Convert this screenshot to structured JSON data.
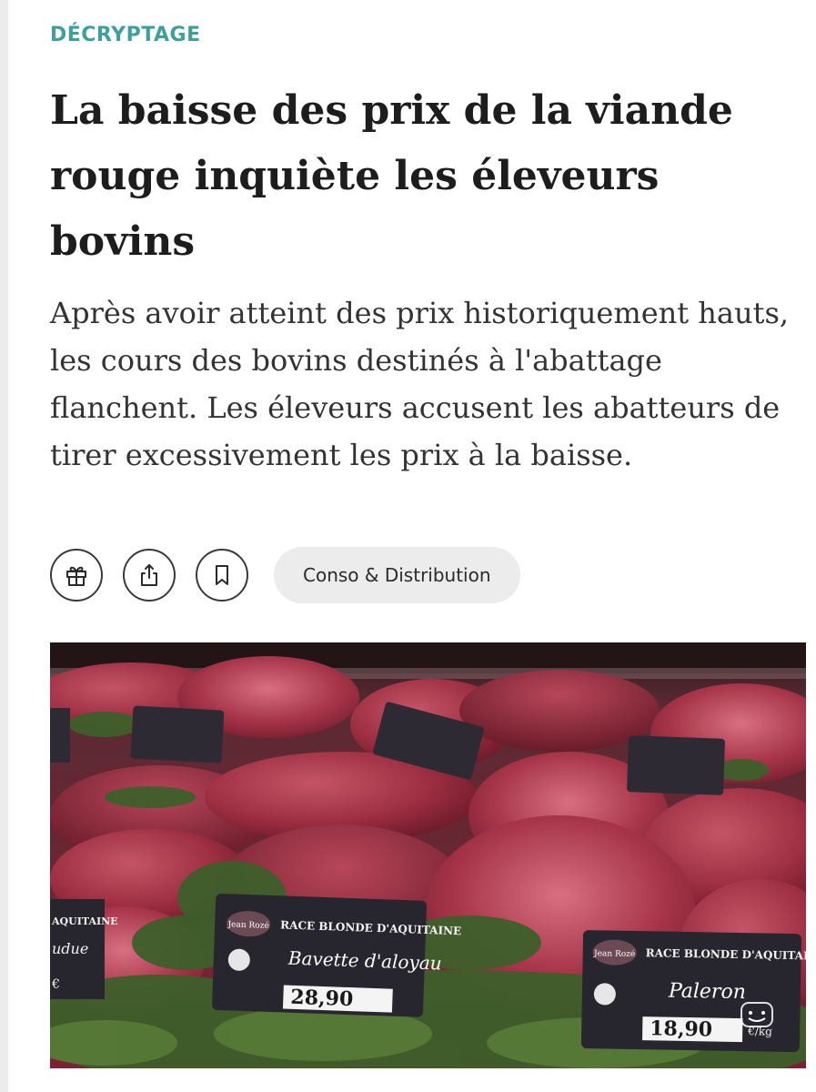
{
  "article": {
    "kicker": "DÉCRYPTAGE",
    "headline": "La baisse des prix de la viande rouge inquiète les éleveurs bovins",
    "lede": "Après avoir atteint des prix historiquement hauts, les cours des bovins destinés à l'abattage flanchent. Les éleveurs accusent les abatteurs de tirer excessivement les prix à la baisse.",
    "category_tag": "Conso & Distribution"
  },
  "actions": {
    "gift_icon": "gift-icon",
    "share_icon": "share-icon",
    "bookmark_icon": "bookmark-icon"
  },
  "hero_image": {
    "description_icon": "photo",
    "labels": [
      {
        "breed": "RACE BLONDE D'AQUITAINE",
        "cut": "Bavette d'aloyau",
        "price": "28,90",
        "unit": "€"
      },
      {
        "breed": "RACE BLONDE D'AQUITAINE",
        "cut": "Paleron",
        "price": "18,90",
        "unit": "€/kg"
      }
    ],
    "left_label": {
      "breed": "AQUITAINE",
      "cut": "udue",
      "price": "€"
    },
    "brand": "Jean Rozé"
  }
}
